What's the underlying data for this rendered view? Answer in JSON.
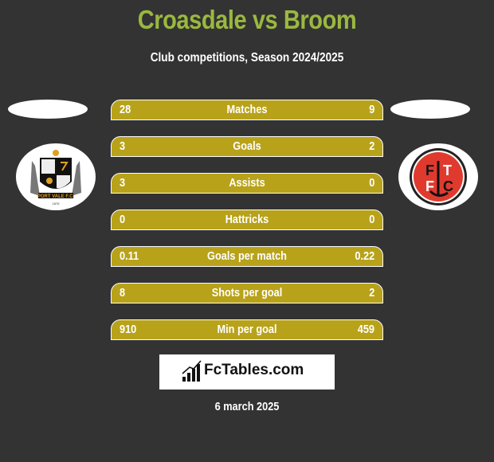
{
  "header": {
    "title": "Croasdale vs Broom",
    "subtitle": "Club competitions, Season 2024/2025"
  },
  "teams": {
    "left": {
      "name": "Port Vale F.C.",
      "logo_text": "PORT VALE F.C.",
      "logo_year": "1876"
    },
    "right": {
      "name": "Fleetwood Town F.C.",
      "logo_text": "FTFC"
    }
  },
  "stats": [
    {
      "label": "Matches",
      "left": "28",
      "right": "9"
    },
    {
      "label": "Goals",
      "left": "3",
      "right": "2"
    },
    {
      "label": "Assists",
      "left": "3",
      "right": "0"
    },
    {
      "label": "Hattricks",
      "left": "0",
      "right": "0"
    },
    {
      "label": "Goals per match",
      "left": "0.11",
      "right": "0.22"
    },
    {
      "label": "Shots per goal",
      "left": "8",
      "right": "2"
    },
    {
      "label": "Min per goal",
      "left": "910",
      "right": "459"
    }
  ],
  "brand": {
    "name": "FcTables.com",
    "icon": "bar-chart-icon"
  },
  "date": "6 march 2025",
  "colors": {
    "title": "#9ab840",
    "bar": "#b8a21a",
    "background": "#333333"
  }
}
